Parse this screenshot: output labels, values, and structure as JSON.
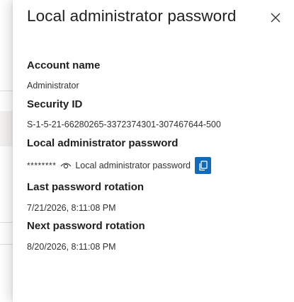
{
  "panel": {
    "title": "Local administrator password",
    "close_icon": "close-icon"
  },
  "fields": {
    "account_name": {
      "label": "Account name",
      "value": "Administrator"
    },
    "security_id": {
      "label": "Security ID",
      "value": "S-1-5-21-66280265-3372374301-307467644-500"
    },
    "local_admin_password": {
      "label": "Local administrator password",
      "masked_value": "********",
      "reveal_icon": "eye-icon",
      "reveal_text": "Local administrator password",
      "copy_icon": "copy-icon"
    },
    "last_rotation": {
      "label": "Last password rotation",
      "value": "7/21/2026, 8:11:08 PM"
    },
    "next_rotation": {
      "label": "Next password rotation",
      "value": "8/20/2026, 8:11:08 PM"
    }
  },
  "colors": {
    "accent": "#0f6cbd",
    "text_primary": "#201f1e",
    "text_secondary": "#323130"
  }
}
